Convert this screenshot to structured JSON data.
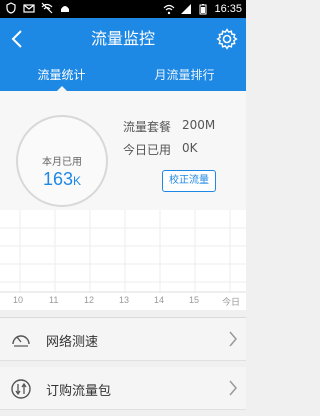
{
  "status_bar": {
    "time": "16:35"
  },
  "appbar": {
    "title": "流量监控"
  },
  "tabs": [
    {
      "label": "流量统计",
      "active": true
    },
    {
      "label": "月流量排行",
      "active": false
    }
  ],
  "summary": {
    "month_used_label": "本月已用",
    "month_used_value": "163",
    "month_used_unit": "K",
    "plan_label": "流量套餐",
    "plan_value": "200M",
    "today_label": "今日已用",
    "today_value": "0K",
    "calibrate_label": "校正流量"
  },
  "chart_ticks": [
    "10",
    "11",
    "12",
    "13",
    "14",
    "15",
    "今日"
  ],
  "list": [
    {
      "label": "网络测速",
      "icon": "speedometer-icon"
    },
    {
      "label": "订购流量包",
      "icon": "traffic-package-icon"
    }
  ],
  "colors": {
    "accent": "#1e88e5",
    "status_bar": "#000000"
  }
}
